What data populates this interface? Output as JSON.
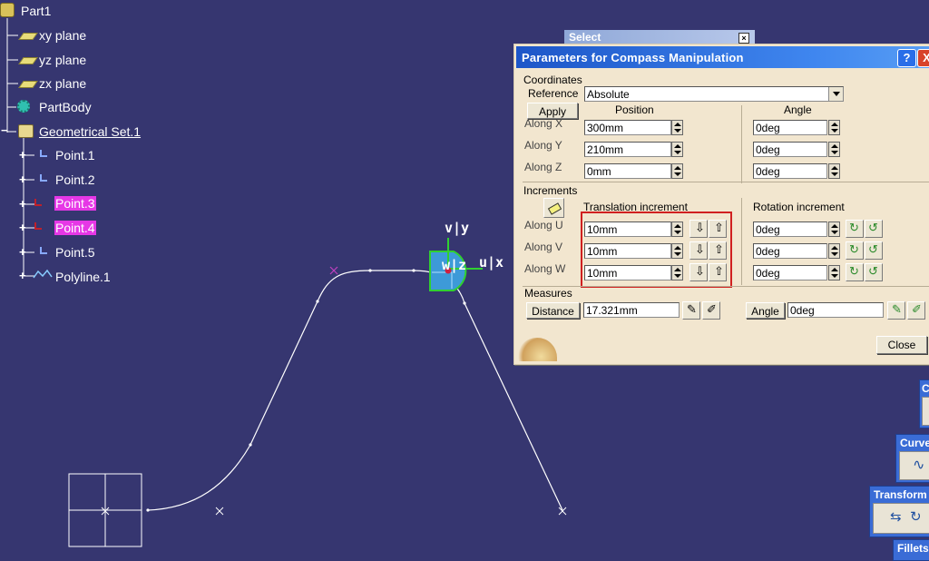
{
  "tree": {
    "root": "Part1",
    "items": [
      {
        "label": "xy plane"
      },
      {
        "label": "yz plane"
      },
      {
        "label": "zx plane"
      },
      {
        "label": "PartBody"
      },
      {
        "label": "Geometrical Set.1"
      },
      {
        "label": "Point.1"
      },
      {
        "label": "Point.2"
      },
      {
        "label": "Point.3"
      },
      {
        "label": "Point.4"
      },
      {
        "label": "Point.5"
      },
      {
        "label": "Polyline.1"
      }
    ]
  },
  "compass": {
    "v_label": "v|y",
    "u_label": "u|x",
    "w_label": "w|z"
  },
  "select_bar": {
    "title": "Select"
  },
  "dialog": {
    "title": "Parameters for Compass Manipulation",
    "help_btn": "?",
    "close_x": "X",
    "coordinates": {
      "section": "Coordinates",
      "reference_label": "Reference",
      "reference_value": "Absolute",
      "apply": "Apply",
      "position_header": "Position",
      "angle_header": "Angle",
      "rows": [
        {
          "label": "Along X",
          "position": "300mm",
          "angle": "0deg"
        },
        {
          "label": "Along Y",
          "position": "210mm",
          "angle": "0deg"
        },
        {
          "label": "Along Z",
          "position": "0mm",
          "angle": "0deg"
        }
      ]
    },
    "increments": {
      "section": "Increments",
      "translation_header": "Translation increment",
      "rotation_header": "Rotation increment",
      "rows": [
        {
          "label": "Along U",
          "translation": "10mm",
          "rotation": "0deg"
        },
        {
          "label": "Along V",
          "translation": "10mm",
          "rotation": "0deg"
        },
        {
          "label": "Along W",
          "translation": "10mm",
          "rotation": "0deg"
        }
      ]
    },
    "measures": {
      "section": "Measures",
      "distance_btn": "Distance",
      "distance_value": "17.321mm",
      "angle_btn": "Angle",
      "angle_value": "0deg"
    },
    "close_btn": "Close"
  },
  "toolbars": [
    {
      "title": "C"
    },
    {
      "title": "Curve"
    },
    {
      "title": "Transform"
    },
    {
      "title": "Fillets"
    }
  ],
  "colors": {
    "background": "#363670",
    "highlight": "#e637e6",
    "accent": "#d02020"
  }
}
